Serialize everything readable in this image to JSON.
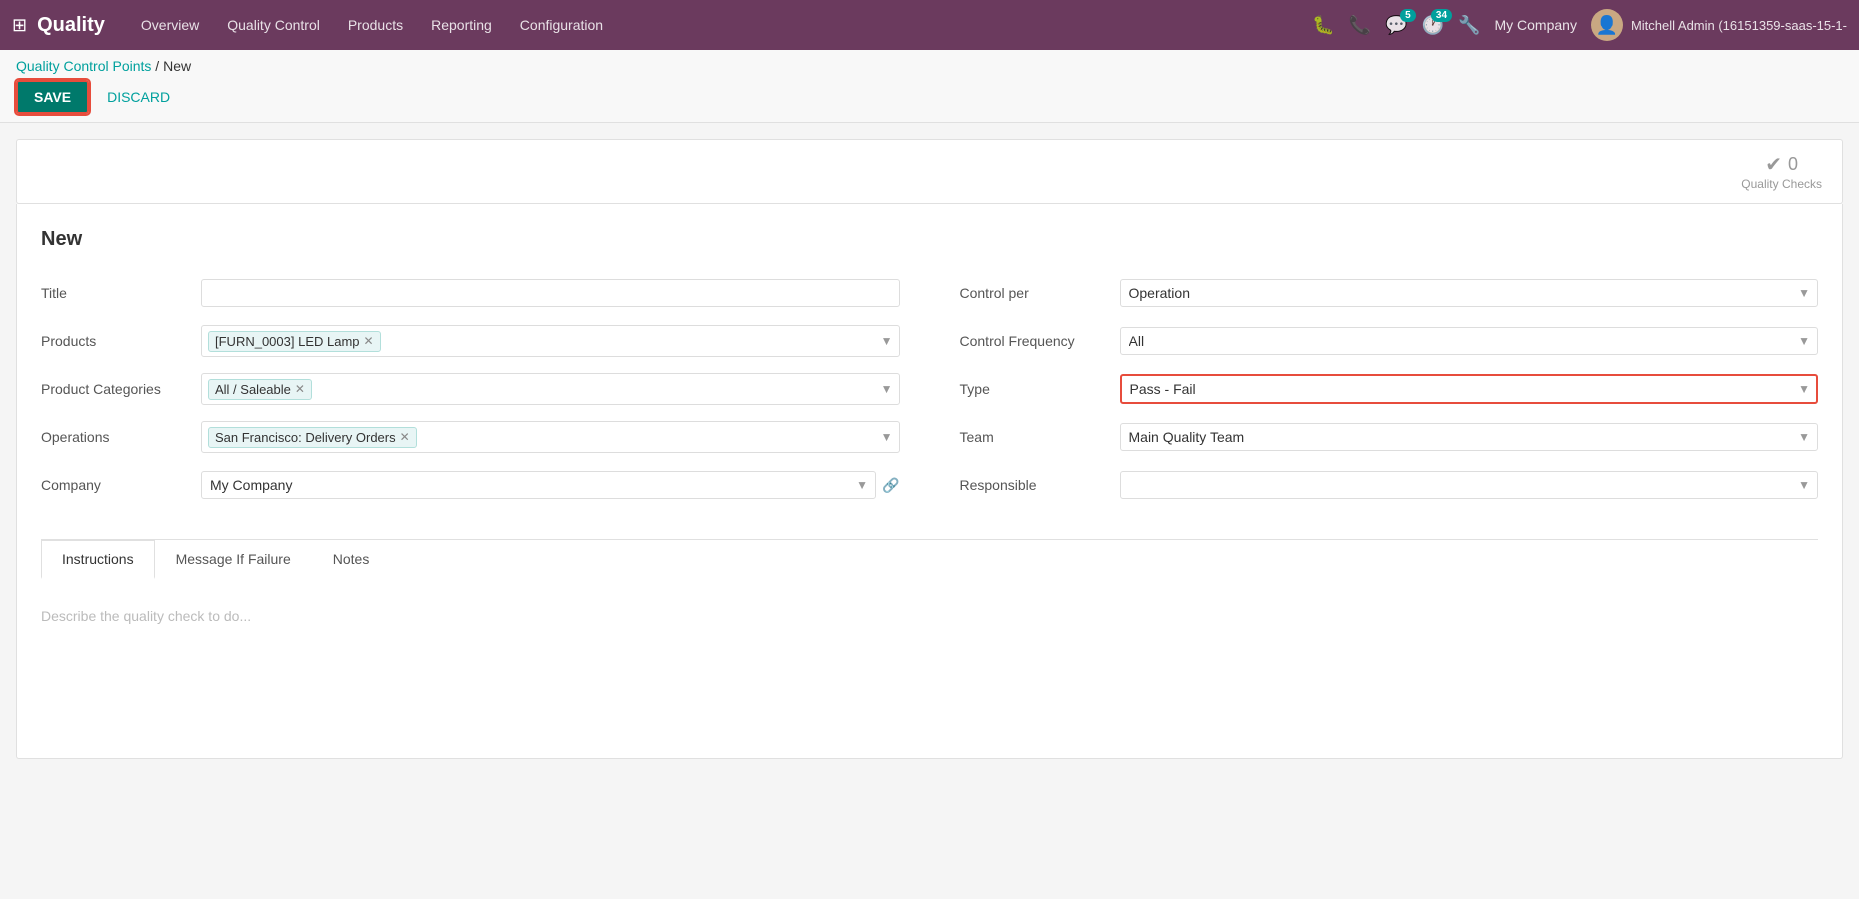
{
  "topnav": {
    "brand": "Quality",
    "links": [
      "Overview",
      "Quality Control",
      "Products",
      "Reporting",
      "Configuration"
    ],
    "company": "My Company",
    "username": "Mitchell Admin (16151359-saas-15-1-",
    "badge_chat": "5",
    "badge_activity": "34"
  },
  "breadcrumb": {
    "parent": "Quality Control Points",
    "separator": "/",
    "current": "New"
  },
  "toolbar": {
    "save_label": "SAVE",
    "discard_label": "DISCARD"
  },
  "stats": {
    "quality_checks_count": "0",
    "quality_checks_label": "Quality Checks"
  },
  "form": {
    "title": "New",
    "left": {
      "title_label": "Title",
      "title_value": "",
      "products_label": "Products",
      "products_tags": [
        "[FURN_0003] LED Lamp"
      ],
      "product_categories_label": "Product Categories",
      "product_categories_tags": [
        "All / Saleable"
      ],
      "operations_label": "Operations",
      "operations_tags": [
        "San Francisco: Delivery Orders"
      ],
      "company_label": "Company",
      "company_value": "My Company"
    },
    "right": {
      "control_per_label": "Control per",
      "control_per_value": "Operation",
      "control_frequency_label": "Control Frequency",
      "control_frequency_value": "All",
      "type_label": "Type",
      "type_value": "Pass - Fail",
      "team_label": "Team",
      "team_value": "Main Quality Team",
      "responsible_label": "Responsible",
      "responsible_value": ""
    }
  },
  "tabs": {
    "items": [
      "Instructions",
      "Message If Failure",
      "Notes"
    ],
    "active_index": 0,
    "instructions_placeholder": "Describe the quality check to do..."
  }
}
